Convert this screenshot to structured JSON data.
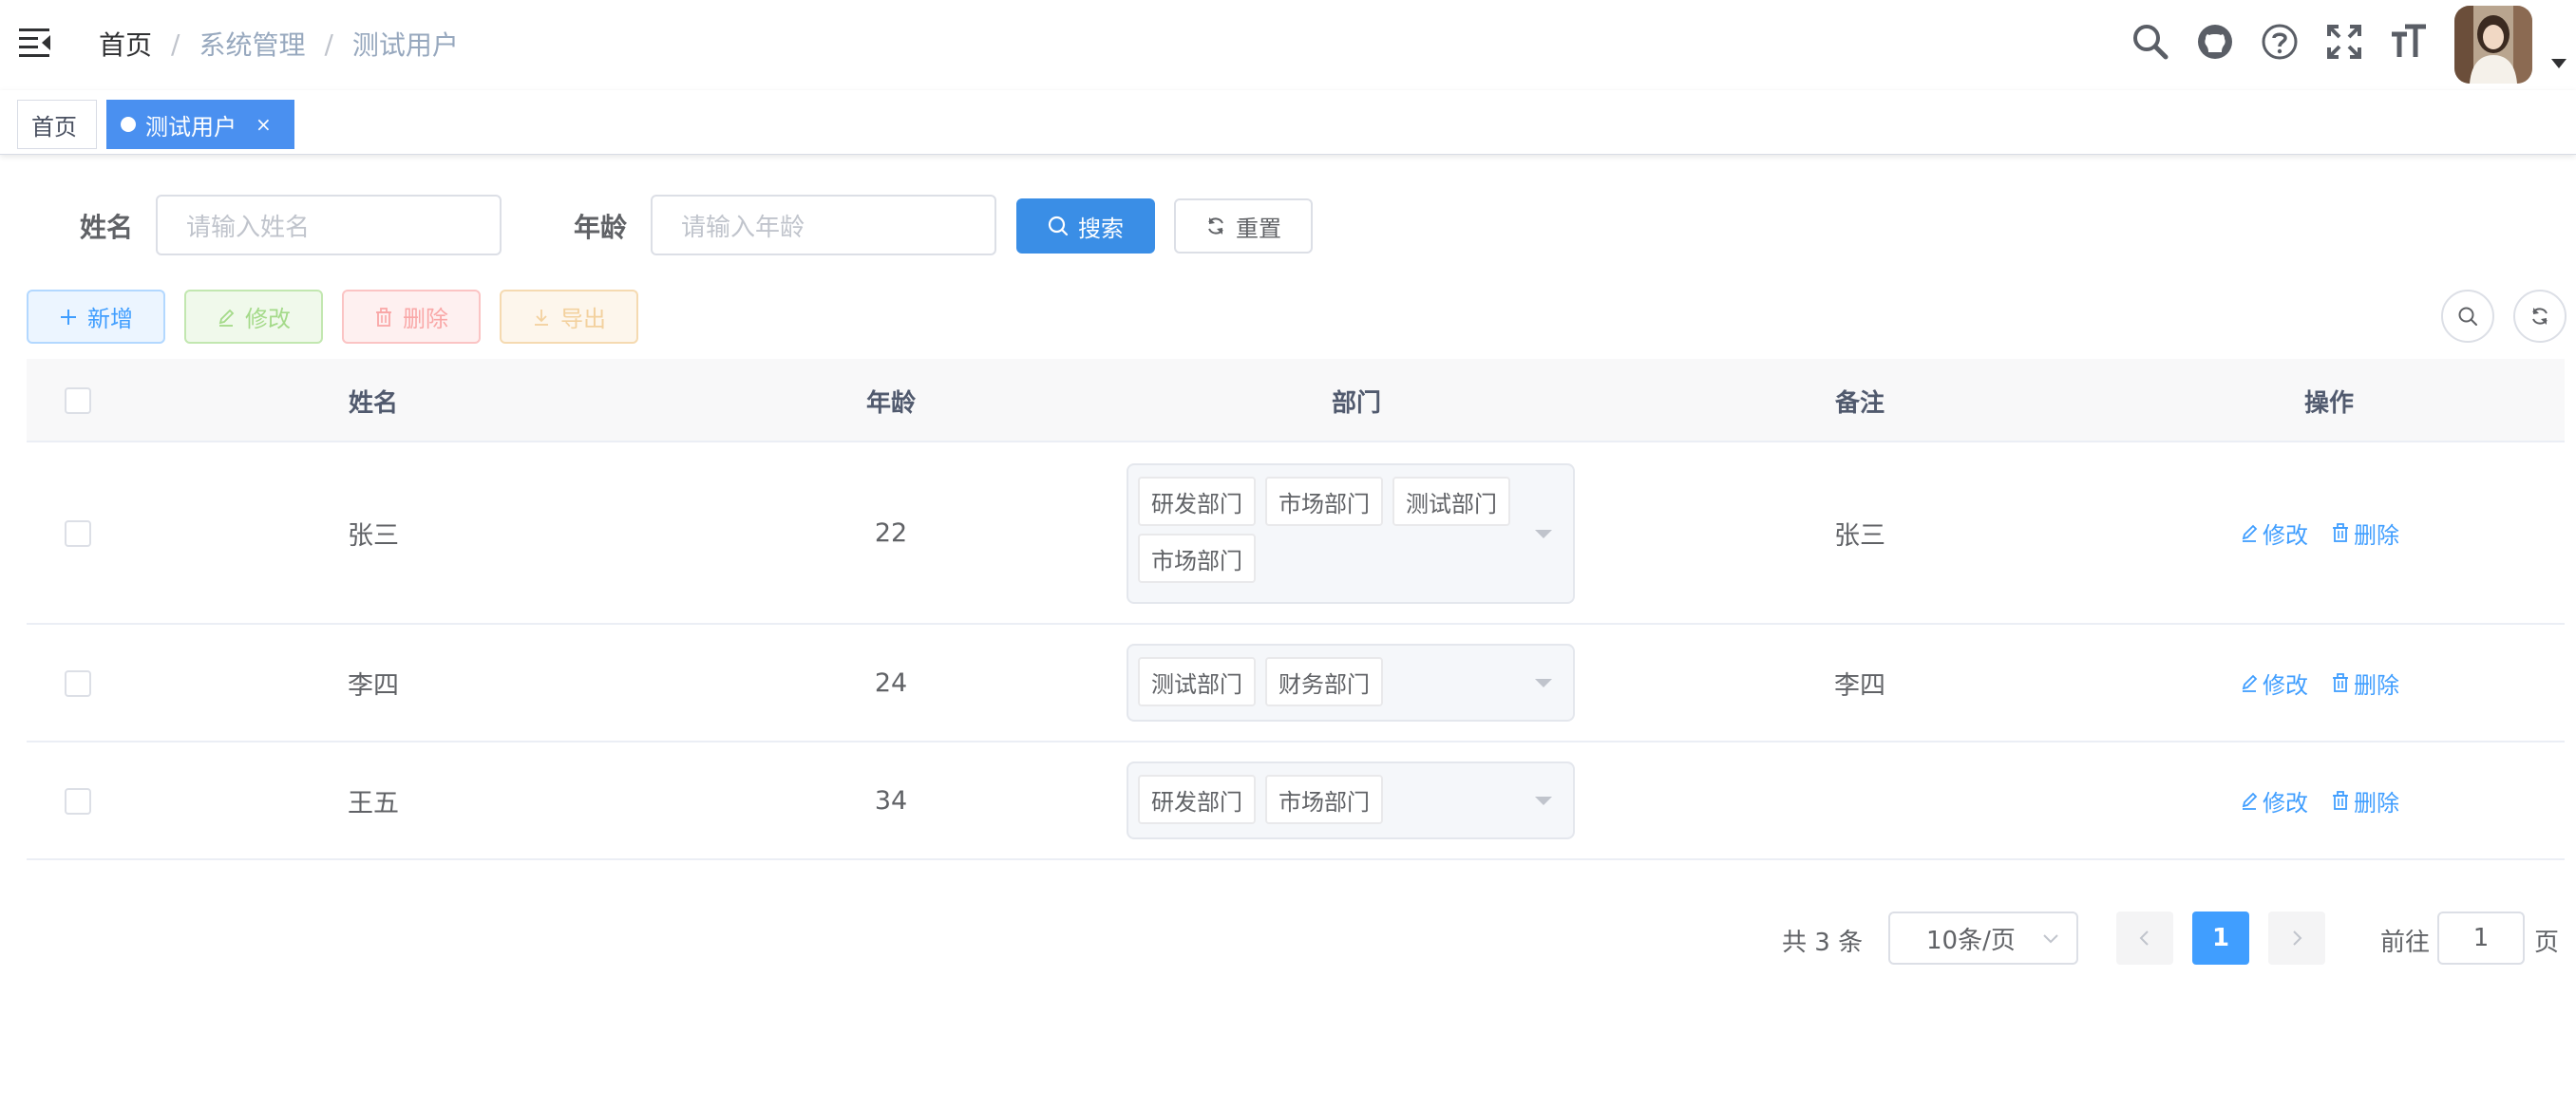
{
  "breadcrumb": {
    "home": "首页",
    "sep1": "/",
    "section": "系统管理",
    "sep2": "/",
    "current": "测试用户"
  },
  "header_icons": [
    "menu-fold-icon",
    "search-icon",
    "github-icon",
    "help-icon",
    "fullscreen-icon",
    "font-size-icon"
  ],
  "tags": {
    "home": "首页",
    "active": "测试用户",
    "close": "×"
  },
  "search": {
    "name_label": "姓名",
    "name_placeholder": "请输入姓名",
    "age_label": "年龄",
    "age_placeholder": "请输入年龄",
    "search_button": "搜索",
    "reset_button": "重置"
  },
  "toolbar": {
    "add": "新增",
    "edit": "修改",
    "delete": "删除",
    "export": "导出"
  },
  "table": {
    "columns": {
      "name": "姓名",
      "age": "年龄",
      "dept": "部门",
      "remark": "备注",
      "action": "操作"
    },
    "rows": [
      {
        "name": "张三",
        "age": "22",
        "depts": [
          "研发部门",
          "市场部门",
          "测试部门",
          "市场部门"
        ],
        "remark": "张三",
        "edit": "修改",
        "delete": "删除"
      },
      {
        "name": "李四",
        "age": "24",
        "depts": [
          "测试部门",
          "财务部门"
        ],
        "remark": "李四",
        "edit": "修改",
        "delete": "删除"
      },
      {
        "name": "王五",
        "age": "34",
        "depts": [
          "研发部门",
          "市场部门"
        ],
        "remark": "",
        "edit": "修改",
        "delete": "删除"
      }
    ]
  },
  "pagination": {
    "total": "共 3 条",
    "page_size": "10条/页",
    "current_page": "1",
    "goto_label": "前往",
    "goto_value": "1",
    "page_suffix": "页"
  },
  "colors": {
    "primary": "#409eff",
    "search_button": "#3a8ee6",
    "active_tag": "#4a90f0"
  }
}
